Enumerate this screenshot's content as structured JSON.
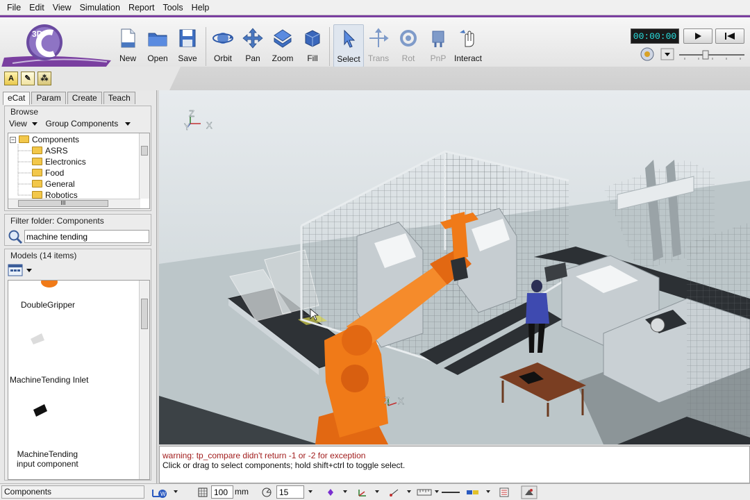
{
  "menu": [
    "File",
    "Edit",
    "View",
    "Simulation",
    "Report",
    "Tools",
    "Help"
  ],
  "logo_text": "3D",
  "toolbar": {
    "file_tools": [
      {
        "label": "New",
        "icon": "new-document-icon"
      },
      {
        "label": "Open",
        "icon": "open-folder-icon"
      },
      {
        "label": "Save",
        "icon": "save-disk-icon"
      }
    ],
    "view_tools": [
      {
        "label": "Orbit",
        "icon": "orbit-icon"
      },
      {
        "label": "Pan",
        "icon": "pan-arrows-icon"
      },
      {
        "label": "Zoom",
        "icon": "zoom-icon"
      },
      {
        "label": "Fill",
        "icon": "fill-cube-icon"
      }
    ],
    "mode_tools": [
      {
        "label": "Select",
        "icon": "select-arrow-icon",
        "active": true
      },
      {
        "label": "Trans",
        "icon": "translate-icon",
        "disabled": true
      },
      {
        "label": "Rot",
        "icon": "rotate-icon",
        "disabled": true
      },
      {
        "label": "PnP",
        "icon": "plug-and-play-icon",
        "disabled": true
      },
      {
        "label": "Interact",
        "icon": "interact-icon"
      }
    ]
  },
  "playback": {
    "time": "00:00:00",
    "play_icon": "play-icon",
    "reset_icon": "skip-back-icon"
  },
  "left_panel": {
    "tabs": [
      "eCat",
      "Param",
      "Create",
      "Teach"
    ],
    "selected_tab": "eCat",
    "browse": {
      "title": "Browse",
      "view_label": "View",
      "group_label": "Group Components",
      "tree": [
        {
          "label": "Components",
          "level": 0,
          "expander": "−"
        },
        {
          "label": "ASRS",
          "level": 1
        },
        {
          "label": "Electronics",
          "level": 1
        },
        {
          "label": "Food",
          "level": 1
        },
        {
          "label": "General",
          "level": 1
        },
        {
          "label": "Robotics",
          "level": 1
        }
      ],
      "hscroll_grip": "III"
    },
    "filter": {
      "title": "Filter folder: Components",
      "value": "machine tending"
    },
    "models": {
      "title": "Models (14 items)",
      "items": [
        {
          "label": "DoubleGripper"
        },
        {
          "label": "MachineTending Inlet"
        },
        {
          "label": "MachineTending\ninput component"
        }
      ]
    }
  },
  "viewport": {
    "axis_labels": {
      "z": "Z",
      "y": "Y",
      "x": "X"
    },
    "robot_axis": {
      "z": "Z",
      "x": "X"
    }
  },
  "output": {
    "warning": "warning: tp_compare didn't return -1 or -2 for exception",
    "info": "Click or drag to select components; hold shift+ctrl to toggle select."
  },
  "statusbar": {
    "text": "Components",
    "grid_value": "100",
    "grid_unit": "mm",
    "angle_value": "15"
  },
  "colors": {
    "accent": "#7a3fa0",
    "robot": "#f07a18",
    "timer_text": "#28e0e0",
    "warning": "#a11c1c"
  }
}
